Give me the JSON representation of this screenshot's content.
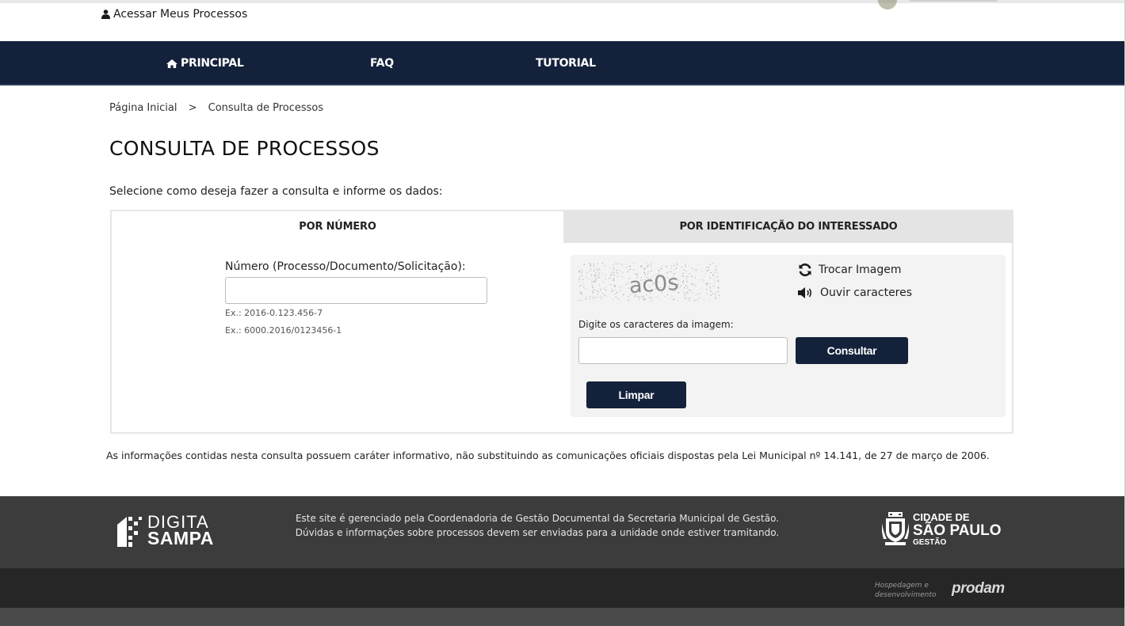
{
  "header": {
    "access_label": "Acessar Meus Processos",
    "access_icon": "user-icon"
  },
  "nav": {
    "items": [
      {
        "label": "PRINCIPAL",
        "icon": "home-icon"
      },
      {
        "label": "FAQ"
      },
      {
        "label": "TUTORIAL"
      }
    ]
  },
  "breadcrumb": {
    "home": "Página Inicial",
    "separator": ">",
    "current": "Consulta de Processos"
  },
  "page": {
    "title": "CONSULTA DE PROCESSOS",
    "intro": "Selecione como deseja fazer a consulta e informe os dados:"
  },
  "tabs": [
    {
      "label": "POR NÚMERO",
      "active": true
    },
    {
      "label": "POR IDENTIFICAÇÃO DO INTERESSADO",
      "active": false
    }
  ],
  "form": {
    "number_label": "Número (Processo/Documento/Solicitação):",
    "number_value": "",
    "example_1": "Ex.: 2016-0.123.456-7",
    "example_2": "Ex.: 6000.2016/0123456-1"
  },
  "captcha": {
    "image_text": "ac0s",
    "change_image": "Trocar Imagem",
    "listen": "Ouvir caracteres",
    "input_label": "Digite os caracteres da imagem:",
    "input_value": "",
    "submit_label": "Consultar",
    "clear_label": "Limpar"
  },
  "disclaimer": "As informações contidas nesta consulta possuem caráter informativo, não substituindo as comunicações oficiais dispostas pela Lei Municipal nº 14.141, de 27 de março de 2006.",
  "footer": {
    "brand_line1": "DIGITA",
    "brand_line2": "SAMPA",
    "message_line1": "Este site é gerenciado pela Coordenadoria de Gestão Documental da Secretaria Municipal de Gestão.",
    "message_line2": "Dúvidas e informações sobre processos devem ser enviadas para a unidade onde estiver tramitando.",
    "city_line1": "CIDADE DE",
    "city_line2": "SÃO PAULO",
    "city_line3": "GESTÃO",
    "host_line1": "Hospedagem e",
    "host_line2": "desenvolvimento",
    "host_brand": "prodam"
  },
  "colors": {
    "navy": "#13213b",
    "footer_dark": "#3c3c3c",
    "subfooter": "#262626",
    "tab_inactive": "#e4e4e4",
    "captcha_bg": "#f3f3f3"
  }
}
